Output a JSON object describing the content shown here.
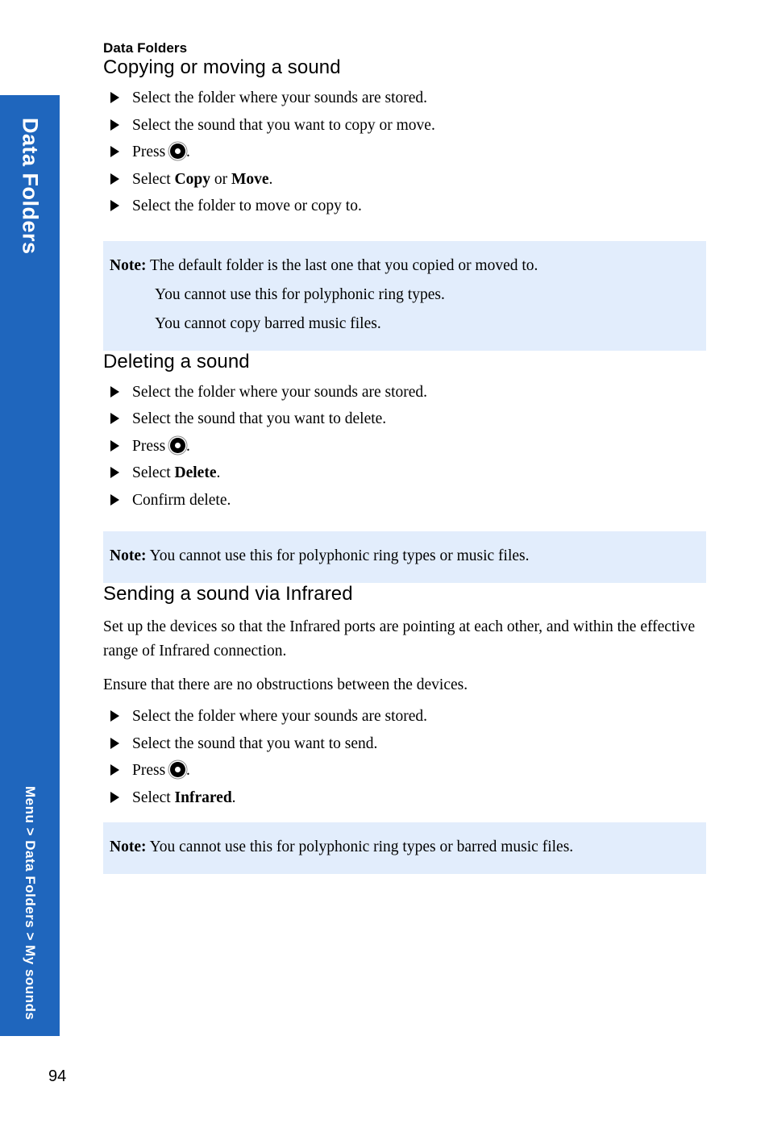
{
  "page": {
    "running_head": "Data Folders",
    "page_number": "94"
  },
  "side_tab": {
    "chapter_label": "Data Folders",
    "breadcrumb": "Menu > Data Folders > My sounds",
    "color": "#1f66bd"
  },
  "note_box": {
    "background_color": "#e2edfc",
    "label": "Note:"
  },
  "icons": {
    "key_center": "center-select-key-icon",
    "bullet": "triangle-right-bullet-icon"
  },
  "sections": [
    {
      "heading": "Copying or moving a sound",
      "steps": [
        {
          "before": "Select the folder where your sounds are stored.",
          "bold": "",
          "after": "",
          "has_key": false
        },
        {
          "before": "Select the sound that you want to copy or move.",
          "bold": "",
          "after": "",
          "has_key": false
        },
        {
          "before": "Press ",
          "bold": "",
          "after": ".",
          "has_key": true
        },
        {
          "before": "Select ",
          "bold": "Copy",
          "mid": " or ",
          "bold2": "Move",
          "after": ".",
          "has_key": false
        },
        {
          "before": "Select the folder to move or copy to.",
          "bold": "",
          "after": "",
          "has_key": false
        }
      ],
      "note_lines": [
        "The default folder is the last one that you copied or moved to.",
        "You cannot use this for polyphonic ring types.",
        "You cannot copy barred music files."
      ]
    },
    {
      "heading": "Deleting a sound",
      "steps": [
        {
          "before": "Select the folder where your sounds are stored.",
          "bold": "",
          "after": "",
          "has_key": false
        },
        {
          "before": "Select the sound that you want to delete.",
          "bold": "",
          "after": "",
          "has_key": false
        },
        {
          "before": "Press ",
          "bold": "",
          "after": ".",
          "has_key": true
        },
        {
          "before": "Select ",
          "bold": "Delete",
          "after": ".",
          "has_key": false
        },
        {
          "before": "Confirm delete.",
          "bold": "",
          "after": "",
          "has_key": false
        }
      ],
      "note_lines": [
        "You cannot use this for polyphonic ring types or music files."
      ]
    },
    {
      "heading": "Sending a sound via Infrared",
      "paragraphs": [
        "Set up the devices so that the Infrared ports are pointing at each other, and within the effective range of Infrared connection.",
        "Ensure that there are no obstructions between the devices."
      ],
      "steps": [
        {
          "before": "Select the folder where your sounds are stored.",
          "bold": "",
          "after": "",
          "has_key": false
        },
        {
          "before": "Select the sound that you want to send.",
          "bold": "",
          "after": "",
          "has_key": false
        },
        {
          "before": "Press ",
          "bold": "",
          "after": ".",
          "has_key": true
        },
        {
          "before": "Select ",
          "bold": "Infrared",
          "after": ".",
          "has_key": false
        }
      ],
      "note_lines": [
        "You cannot use this for polyphonic ring types or barred music files."
      ]
    }
  ]
}
